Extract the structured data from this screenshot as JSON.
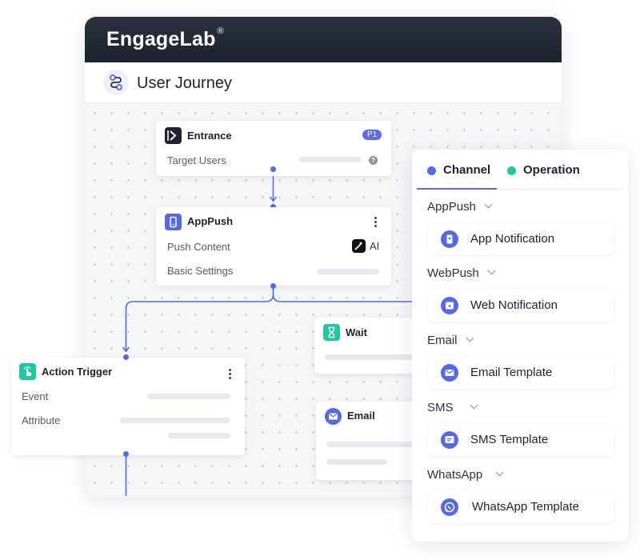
{
  "app": {
    "brand": "EngageLab",
    "brand_mark": "®",
    "page_title": "User Journey"
  },
  "canvas": {
    "entrance": {
      "title": "Entrance",
      "badge": "P1",
      "rows": [
        "Target Users"
      ],
      "help": "?"
    },
    "apppush": {
      "title": "AppPush",
      "rows": [
        "Push Content",
        "Basic Settings"
      ],
      "ai_label": "AI"
    },
    "wait": {
      "title": "Wait"
    },
    "email": {
      "title": "Email"
    },
    "action_trigger": {
      "title": "Action Trigger",
      "rows": [
        "Event",
        "Attribute"
      ]
    }
  },
  "panel": {
    "tabs": [
      {
        "label": "Channel",
        "color": "#5468e8",
        "active": true
      },
      {
        "label": "Operation",
        "color": "#1fc8a0",
        "active": false
      }
    ],
    "groups": [
      {
        "label": "AppPush",
        "item": "App Notification",
        "icon": "app-notification-icon"
      },
      {
        "label": "WebPush",
        "item": "Web Notification",
        "icon": "web-notification-icon"
      },
      {
        "label": "Email",
        "item": "Email Template",
        "icon": "email-icon"
      },
      {
        "label": "SMS",
        "item": "SMS Template",
        "icon": "sms-icon"
      },
      {
        "label": "WhatsApp",
        "item": "WhatsApp Template",
        "icon": "whatsapp-icon"
      }
    ]
  },
  "colors": {
    "accent": "#5468e8",
    "teal": "#1fc8a0",
    "header_dark": "#1f2430"
  }
}
